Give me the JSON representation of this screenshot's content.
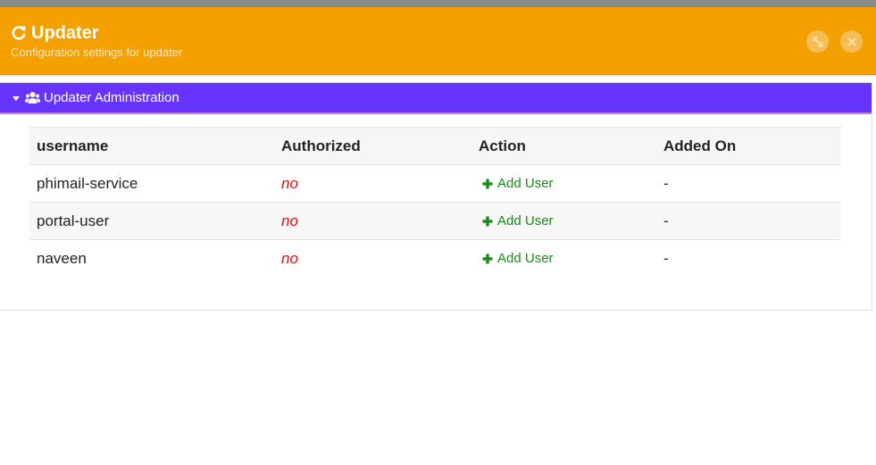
{
  "header": {
    "title": "Updater",
    "subtitle": "Configuration settings for updater",
    "color": "#f4a000"
  },
  "panel": {
    "title": "Updater Administration",
    "color": "#6633ff"
  },
  "table": {
    "columns": [
      "username",
      "Authorized",
      "Action",
      "Added On"
    ],
    "rows": [
      {
        "username": "phimail-service",
        "authorized": "no",
        "action": "Add User",
        "added_on": "-"
      },
      {
        "username": "portal-user",
        "authorized": "no",
        "action": "Add User",
        "added_on": "-"
      },
      {
        "username": "naveen",
        "authorized": "no",
        "action": "Add User",
        "added_on": "-"
      }
    ]
  },
  "icons": {
    "title": "refresh-icon",
    "expand": "expand-icon",
    "close": "close-icon",
    "panel_toggle": "caret-down-icon",
    "panel": "users-icon",
    "action": "plus-icon"
  }
}
